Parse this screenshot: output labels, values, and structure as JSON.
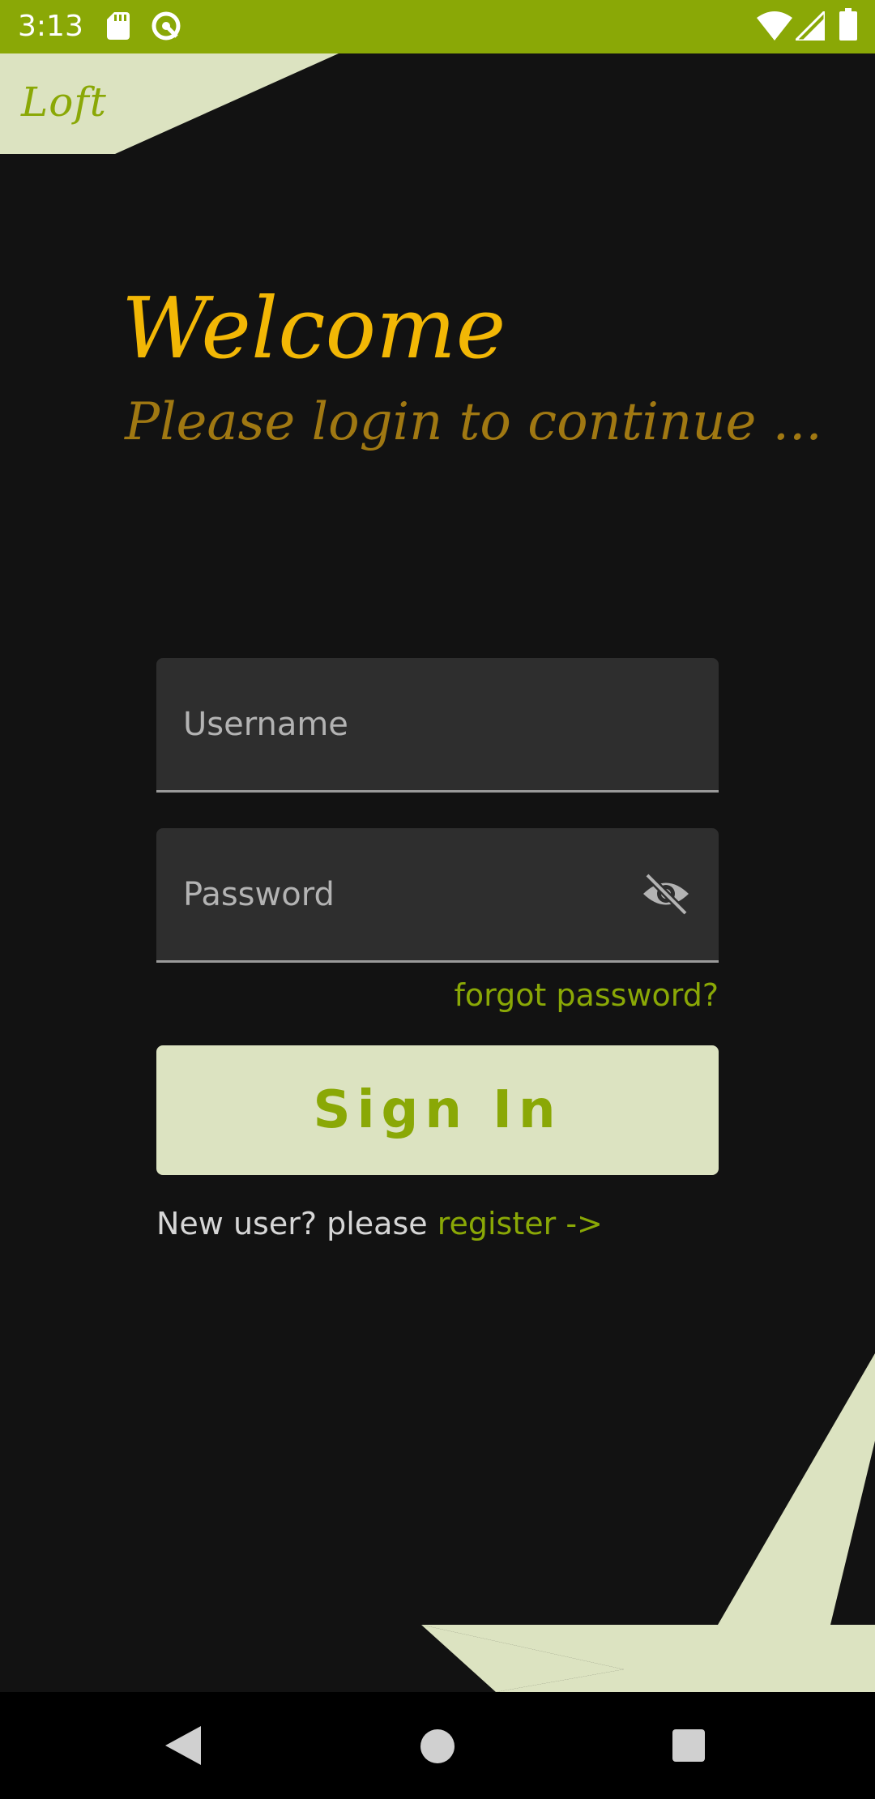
{
  "status_bar": {
    "time": "3:13",
    "icons": [
      "sd-card-icon",
      "vpn-key-icon",
      "wifi-icon",
      "cellular-icon",
      "battery-icon"
    ],
    "background": "#8aa806"
  },
  "app": {
    "logo": "Loft"
  },
  "welcome": {
    "title": "Welcome",
    "subtitle": "Please login to continue ..."
  },
  "form": {
    "username_placeholder": "Username",
    "username_value": "",
    "password_placeholder": "Password",
    "password_value": "",
    "password_toggle_icon": "visibility-off-icon",
    "forgot_password": "forgot password?",
    "sign_in_label": "Sign In"
  },
  "register": {
    "prefix": "New user? please ",
    "link": "register ->"
  },
  "nav_bar": {
    "icons": [
      "back-icon",
      "home-icon",
      "recents-icon"
    ]
  },
  "colors": {
    "accent_green": "#8aa806",
    "pale_green": "#dce3c1",
    "welcome_gold": "#f2b705",
    "subtitle_gold": "#a07812",
    "background": "#121212",
    "field_background": "#2e2e2e"
  }
}
